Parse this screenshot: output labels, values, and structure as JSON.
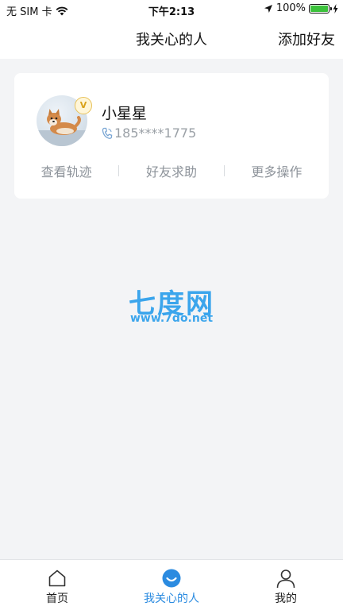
{
  "status_bar": {
    "carrier": "无 SIM 卡",
    "time": "下午2:13",
    "battery_percent": "100%",
    "battery_level": 1.0,
    "icons": [
      "wifi-icon",
      "location-arrow-icon",
      "battery-icon",
      "charging-bolt-icon"
    ]
  },
  "nav": {
    "title": "我关心的人",
    "add_friend": "添加好友"
  },
  "friend_card": {
    "name": "小星星",
    "phone": "185****1775",
    "vip_badge": "V",
    "avatar_icon": "dog-avatar",
    "actions": [
      "查看轨迹",
      "好友求助",
      "更多操作"
    ]
  },
  "watermark": {
    "title": "七度网",
    "url": "www.7do.net",
    "color": "#3ba5ec"
  },
  "tabs": [
    {
      "label": "首页",
      "icon": "home-icon",
      "active": false
    },
    {
      "label": "我关心的人",
      "icon": "smile-icon",
      "active": true
    },
    {
      "label": "我的",
      "icon": "user-icon",
      "active": false
    }
  ],
  "colors": {
    "accent": "#2b8be0",
    "background": "#f3f4f6",
    "muted_text": "#8d939a"
  }
}
